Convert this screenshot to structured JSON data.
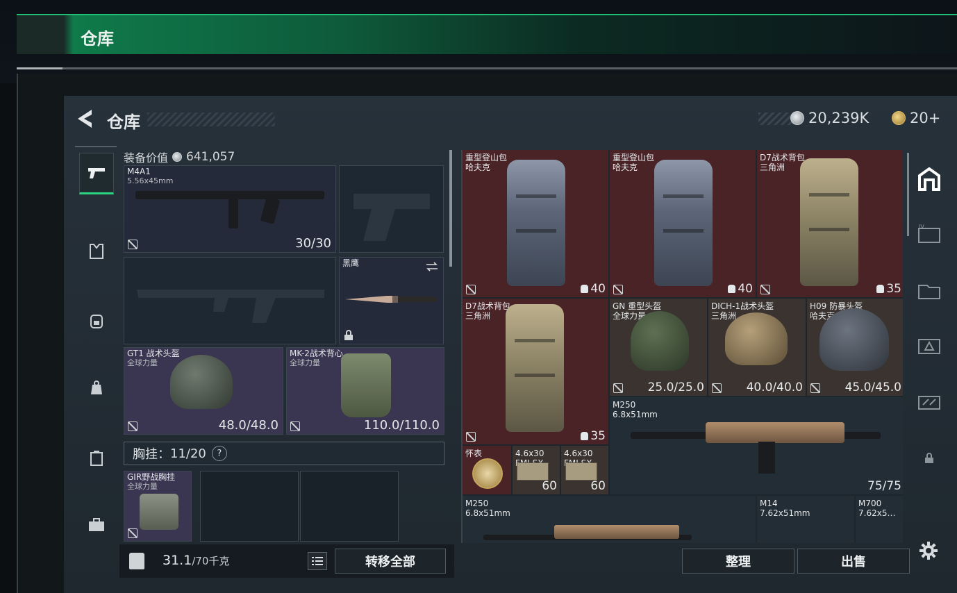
{
  "banner": {
    "title": "仓库"
  },
  "header": {
    "title": "仓库",
    "currency_main": "20,239K",
    "currency_premium": "20+"
  },
  "equipment": {
    "value_label": "装备价值",
    "value": "641,057",
    "primary_weapon": {
      "name": "M4A1",
      "caliber": "5.56x45mm",
      "ammo": "30/30"
    },
    "melee": {
      "name": "黑鹰"
    },
    "helmet": {
      "name": "GT1 战术头盔",
      "faction": "全球力量",
      "durability": "48.0/48.0"
    },
    "armor": {
      "name": "MK-2战术背心",
      "faction": "全球力量",
      "durability": "110.0/110.0"
    },
    "chest_rig_label": "胸挂：",
    "chest_rig_capacity": "11/20",
    "chest_rig_help": "?",
    "chest_rig": {
      "name": "GIR野战胸挂",
      "faction": "全球力量"
    }
  },
  "footer": {
    "weight": "31.1",
    "weight_max": "/70千克",
    "transfer_all": "转移全部",
    "sort": "整理",
    "sell": "出售"
  },
  "stash": {
    "items": [
      {
        "name": "重型登山包",
        "faction": "哈夫克",
        "capacity": "40"
      },
      {
        "name": "重型登山包",
        "faction": "哈夫克",
        "capacity": "40"
      },
      {
        "name": "D7战术背包",
        "faction": "三角洲",
        "capacity": "35"
      },
      {
        "name": "D7战术背包",
        "faction": "三角洲",
        "capacity": "35"
      },
      {
        "name": "GN 重型头盔",
        "faction": "全球力量",
        "durability": "25.0/25.0"
      },
      {
        "name": "DICH-1战术头盔",
        "faction": "三角洲",
        "durability": "40.0/40.0"
      },
      {
        "name": "H09 防暴头盔",
        "faction": "哈夫克",
        "durability": "45.0/45.0"
      },
      {
        "name": "M250",
        "caliber": "6.8x51mm",
        "ammo": "75/75"
      },
      {
        "name": "怀表"
      },
      {
        "name": "4.6x30",
        "sub": "FMJ SX",
        "count": "60"
      },
      {
        "name": "4.6x30",
        "sub": "FMJ SX",
        "count": "60"
      },
      {
        "name": "M250",
        "caliber": "6.8x51mm"
      },
      {
        "name": "M14",
        "caliber": "7.62x51mm"
      },
      {
        "name": "M700",
        "caliber": "7.62x5…"
      }
    ]
  },
  "colors": {
    "accent": "#2bd47e",
    "stash_red": "#4a2327",
    "equip_purple": "#3a3550"
  }
}
